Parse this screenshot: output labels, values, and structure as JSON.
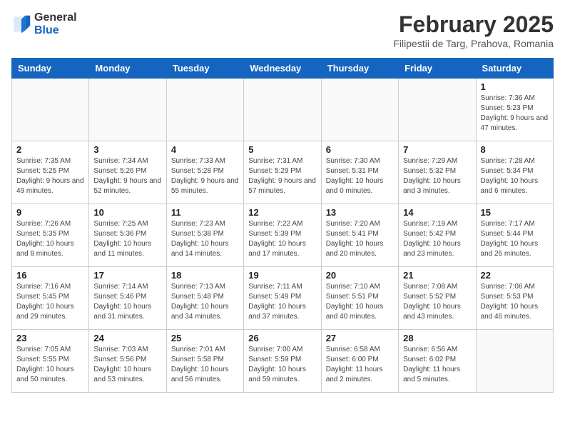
{
  "header": {
    "logo_general": "General",
    "logo_blue": "Blue",
    "month_year": "February 2025",
    "subtitle": "Filipestii de Targ, Prahova, Romania"
  },
  "days_of_week": [
    "Sunday",
    "Monday",
    "Tuesday",
    "Wednesday",
    "Thursday",
    "Friday",
    "Saturday"
  ],
  "weeks": [
    [
      {
        "day": "",
        "empty": true
      },
      {
        "day": "",
        "empty": true
      },
      {
        "day": "",
        "empty": true
      },
      {
        "day": "",
        "empty": true
      },
      {
        "day": "",
        "empty": true
      },
      {
        "day": "",
        "empty": true
      },
      {
        "day": "1",
        "sunrise": "7:36 AM",
        "sunset": "5:23 PM",
        "daylight": "9 hours and 47 minutes."
      }
    ],
    [
      {
        "day": "2",
        "sunrise": "7:35 AM",
        "sunset": "5:25 PM",
        "daylight": "9 hours and 49 minutes."
      },
      {
        "day": "3",
        "sunrise": "7:34 AM",
        "sunset": "5:26 PM",
        "daylight": "9 hours and 52 minutes."
      },
      {
        "day": "4",
        "sunrise": "7:33 AM",
        "sunset": "5:28 PM",
        "daylight": "9 hours and 55 minutes."
      },
      {
        "day": "5",
        "sunrise": "7:31 AM",
        "sunset": "5:29 PM",
        "daylight": "9 hours and 57 minutes."
      },
      {
        "day": "6",
        "sunrise": "7:30 AM",
        "sunset": "5:31 PM",
        "daylight": "10 hours and 0 minutes."
      },
      {
        "day": "7",
        "sunrise": "7:29 AM",
        "sunset": "5:32 PM",
        "daylight": "10 hours and 3 minutes."
      },
      {
        "day": "8",
        "sunrise": "7:28 AM",
        "sunset": "5:34 PM",
        "daylight": "10 hours and 6 minutes."
      }
    ],
    [
      {
        "day": "9",
        "sunrise": "7:26 AM",
        "sunset": "5:35 PM",
        "daylight": "10 hours and 8 minutes."
      },
      {
        "day": "10",
        "sunrise": "7:25 AM",
        "sunset": "5:36 PM",
        "daylight": "10 hours and 11 minutes."
      },
      {
        "day": "11",
        "sunrise": "7:23 AM",
        "sunset": "5:38 PM",
        "daylight": "10 hours and 14 minutes."
      },
      {
        "day": "12",
        "sunrise": "7:22 AM",
        "sunset": "5:39 PM",
        "daylight": "10 hours and 17 minutes."
      },
      {
        "day": "13",
        "sunrise": "7:20 AM",
        "sunset": "5:41 PM",
        "daylight": "10 hours and 20 minutes."
      },
      {
        "day": "14",
        "sunrise": "7:19 AM",
        "sunset": "5:42 PM",
        "daylight": "10 hours and 23 minutes."
      },
      {
        "day": "15",
        "sunrise": "7:17 AM",
        "sunset": "5:44 PM",
        "daylight": "10 hours and 26 minutes."
      }
    ],
    [
      {
        "day": "16",
        "sunrise": "7:16 AM",
        "sunset": "5:45 PM",
        "daylight": "10 hours and 29 minutes."
      },
      {
        "day": "17",
        "sunrise": "7:14 AM",
        "sunset": "5:46 PM",
        "daylight": "10 hours and 31 minutes."
      },
      {
        "day": "18",
        "sunrise": "7:13 AM",
        "sunset": "5:48 PM",
        "daylight": "10 hours and 34 minutes."
      },
      {
        "day": "19",
        "sunrise": "7:11 AM",
        "sunset": "5:49 PM",
        "daylight": "10 hours and 37 minutes."
      },
      {
        "day": "20",
        "sunrise": "7:10 AM",
        "sunset": "5:51 PM",
        "daylight": "10 hours and 40 minutes."
      },
      {
        "day": "21",
        "sunrise": "7:08 AM",
        "sunset": "5:52 PM",
        "daylight": "10 hours and 43 minutes."
      },
      {
        "day": "22",
        "sunrise": "7:06 AM",
        "sunset": "5:53 PM",
        "daylight": "10 hours and 46 minutes."
      }
    ],
    [
      {
        "day": "23",
        "sunrise": "7:05 AM",
        "sunset": "5:55 PM",
        "daylight": "10 hours and 50 minutes."
      },
      {
        "day": "24",
        "sunrise": "7:03 AM",
        "sunset": "5:56 PM",
        "daylight": "10 hours and 53 minutes."
      },
      {
        "day": "25",
        "sunrise": "7:01 AM",
        "sunset": "5:58 PM",
        "daylight": "10 hours and 56 minutes."
      },
      {
        "day": "26",
        "sunrise": "7:00 AM",
        "sunset": "5:59 PM",
        "daylight": "10 hours and 59 minutes."
      },
      {
        "day": "27",
        "sunrise": "6:58 AM",
        "sunset": "6:00 PM",
        "daylight": "11 hours and 2 minutes."
      },
      {
        "day": "28",
        "sunrise": "6:56 AM",
        "sunset": "6:02 PM",
        "daylight": "11 hours and 5 minutes."
      },
      {
        "day": "",
        "empty": true
      }
    ]
  ]
}
